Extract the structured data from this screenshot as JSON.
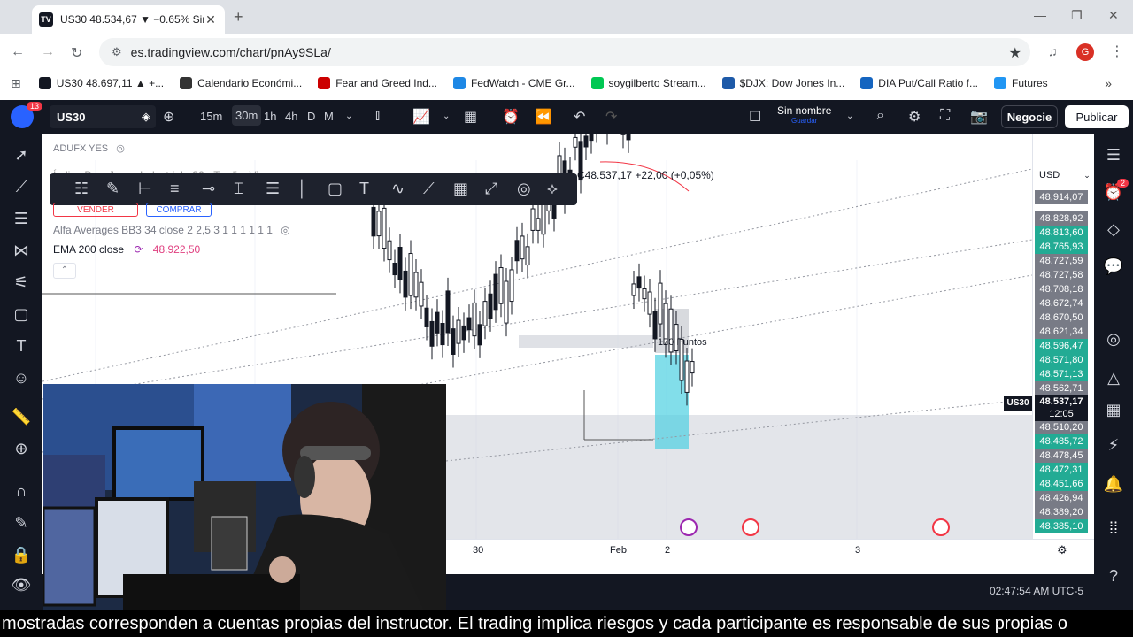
{
  "browser": {
    "tab_title": "US30 48.534,67 ▼ −0.65% Sin n",
    "tab_favicon": "TV",
    "url": "es.tradingview.com/chart/pnAy9SLa/",
    "profile_initial": "G"
  },
  "bookmarks": [
    {
      "label": "US30 48.697,11 ▲ +...",
      "color": "#131722",
      "icon": "TV"
    },
    {
      "label": "Calendario Económi...",
      "color": "#333333",
      "icon": "inv"
    },
    {
      "label": "Fear and Greed Ind...",
      "color": "#cc0000",
      "icon": "CNN"
    },
    {
      "label": "FedWatch - CME Gr...",
      "color": "#1e88e5",
      "icon": "globe"
    },
    {
      "label": "soygilberto Stream...",
      "color": "#00c853",
      "icon": "K"
    },
    {
      "label": "$DJX: Dow Jones In...",
      "color": "#1e5aa8",
      "icon": "sq"
    },
    {
      "label": "DIA Put/Call Ratio f...",
      "color": "#1565c0",
      "icon": "b"
    },
    {
      "label": "Futures",
      "color": "#2196f3",
      "icon": "shield"
    }
  ],
  "tv_top": {
    "logo_badge": "13",
    "symbol": "US30",
    "timeframes": [
      "15m",
      "30m",
      "1h",
      "4h",
      "D",
      "M"
    ],
    "active_timeframe": "30m",
    "layout_name": "Sin nombre",
    "layout_status": "Guardar",
    "trade_button": "Negocie",
    "publish_button": "Publicar"
  },
  "chart": {
    "source_label": "ADUFX YES",
    "title_line": "Índice Dow Jones Industrial · 30 · TradingView",
    "price_readout": "C48.537,17 +22,00 (+0,05%)",
    "sell_button": "VENDER",
    "buy_button": "COMPRAR",
    "indicator_1": "Alfa Averages BB3 34 close 2 2,5 3 1 1 1 1 1 1",
    "indicator_2_label": "EMA 200 close",
    "indicator_2_value": "48.922,50",
    "range_label": "170 Puntos",
    "currency": "USD",
    "symbol_tag": "US30",
    "current_price": "48.537,17",
    "countdown": "12:05",
    "price_levels": [
      {
        "label": "48.914,07",
        "bg": "#787b86"
      },
      {
        "label": "48.828,92",
        "bg": "#787b86"
      },
      {
        "label": "48.813,60",
        "bg": "#22ab94"
      },
      {
        "label": "48.765,93",
        "bg": "#22ab94"
      },
      {
        "label": "48.727,59",
        "bg": "#787b86"
      },
      {
        "label": "48.727,58",
        "bg": "#787b86"
      },
      {
        "label": "48.708,18",
        "bg": "#787b86"
      },
      {
        "label": "48.672,74",
        "bg": "#787b86"
      },
      {
        "label": "48.670,50",
        "bg": "#787b86"
      },
      {
        "label": "48.621,34",
        "bg": "#787b86"
      },
      {
        "label": "48.596,47",
        "bg": "#22ab94"
      },
      {
        "label": "48.571,80",
        "bg": "#22ab94"
      },
      {
        "label": "48.571,13",
        "bg": "#22ab94"
      },
      {
        "label": "48.562,71",
        "bg": "#787b86"
      },
      {
        "label": "48.510,20",
        "bg": "#787b86"
      },
      {
        "label": "48.485,72",
        "bg": "#22ab94"
      },
      {
        "label": "48.478,45",
        "bg": "#787b86"
      },
      {
        "label": "48.472,31",
        "bg": "#22ab94"
      },
      {
        "label": "48.451,66",
        "bg": "#22ab94"
      },
      {
        "label": "48.426,94",
        "bg": "#787b86"
      },
      {
        "label": "48.389,20",
        "bg": "#787b86"
      },
      {
        "label": "48.385,10",
        "bg": "#22ab94"
      }
    ],
    "time_labels": [
      "30",
      "Feb",
      "2",
      "3"
    ]
  },
  "status": {
    "clock": "02:47:54 AM UTC-5"
  },
  "subtitle": "mostradas corresponden a cuentas propias del instructor. El trading implica riesgos y cada participante es responsable de sus propias o",
  "icons": {
    "alert_badge": "2"
  }
}
